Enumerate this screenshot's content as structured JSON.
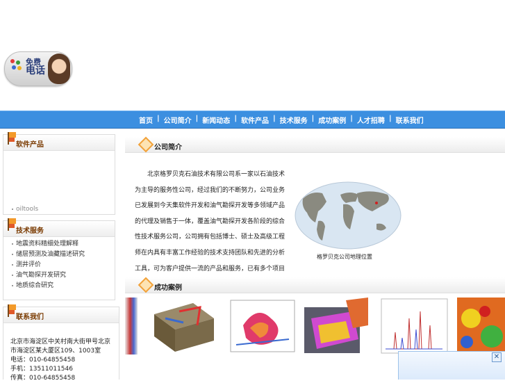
{
  "header": {
    "phone_badge": {
      "line1": "免费",
      "line2": "电话"
    }
  },
  "nav": {
    "items": [
      "首页",
      "公司简介",
      "新闻动态",
      "软件产品",
      "技术服务",
      "成功案例",
      "人才招聘",
      "联系我们"
    ]
  },
  "left": {
    "panel1": {
      "title": "软件产品",
      "items": [
        "oiltools"
      ]
    },
    "panel2": {
      "title": "技术服务",
      "items": [
        "地震资料精细处理解释",
        "储层预测及油藏描述研究",
        "测井评价",
        "油气勘探开发研究",
        "地质综合研究"
      ]
    },
    "panel3": {
      "title": "联系我们",
      "address": "北京市海淀区中关村南大街甲号北京",
      "address2": "市海淀区某大厦区109、1003室",
      "tel": "电话：010-64855458",
      "mobile": "手机：13511011546",
      "fax": "传真：010-64855458"
    }
  },
  "main": {
    "about": {
      "title": "公司简介",
      "text": "北京格罗贝克石油技术有限公司系一家以石油技术为主导的服务性公司，经过我们的不断努力，公司业务已发展到今天集软件开发和油气勘探开发等多领域产品的代理及销售于一体，覆盖油气勘探开发各阶段的综合性技术服务公司，公司拥有包括博士、硕士及高级工程师在内具有丰富工作经验的技术支持团队和先进的分析工具，可为客户提供一流的产品和服务，已有多个项目研究的成功案例。",
      "map_caption": "格罗贝克公司地理位置"
    },
    "cases": {
      "title": "成功案例"
    }
  },
  "popup": {
    "close_label": "✕"
  },
  "colors": {
    "nav": "#3c8fe0",
    "accent": "#f2a23a"
  }
}
